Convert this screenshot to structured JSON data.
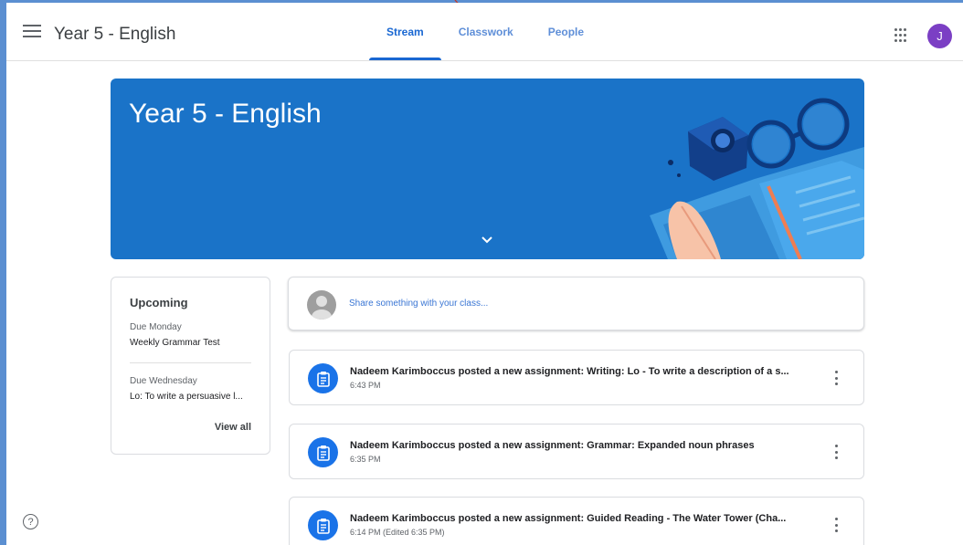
{
  "app": {
    "title": "Year 5 - English"
  },
  "tabs": [
    {
      "label": "Stream",
      "active": true
    },
    {
      "label": "Classwork",
      "active": false
    },
    {
      "label": "People",
      "active": false
    }
  ],
  "user": {
    "avatar_letter": "J",
    "avatar_color": "#7b3fc4"
  },
  "banner": {
    "title": "Year 5 - English",
    "color": "#1a73c8"
  },
  "upcoming": {
    "heading": "Upcoming",
    "items": [
      {
        "due": "Due Monday",
        "title": "Weekly Grammar Test"
      },
      {
        "due": "Due Wednesday",
        "title": "Lo: To write a persuasive l..."
      }
    ],
    "view_all": "View all"
  },
  "share": {
    "placeholder": "Share something with your class..."
  },
  "posts": [
    {
      "title": "Nadeem Karimboccus posted a new assignment: Writing: Lo - To write a description of a s...",
      "time": "6:43 PM"
    },
    {
      "title": "Nadeem Karimboccus posted a new assignment: Grammar: Expanded noun phrases",
      "time": "6:35 PM"
    },
    {
      "title": "Nadeem Karimboccus posted a new assignment: Guided Reading - The Water Tower (Cha...",
      "time": "6:14 PM (Edited 6:35 PM)"
    }
  ],
  "help": {
    "icon": "?"
  },
  "icons": {
    "menu": "hamburger-menu-icon",
    "apps": "apps-grid-icon",
    "assignment": "assignment-icon",
    "more": "more-vert-icon",
    "help": "help-icon"
  },
  "colors": {
    "accent": "#1967d2",
    "frame": "#5b8fd1"
  }
}
